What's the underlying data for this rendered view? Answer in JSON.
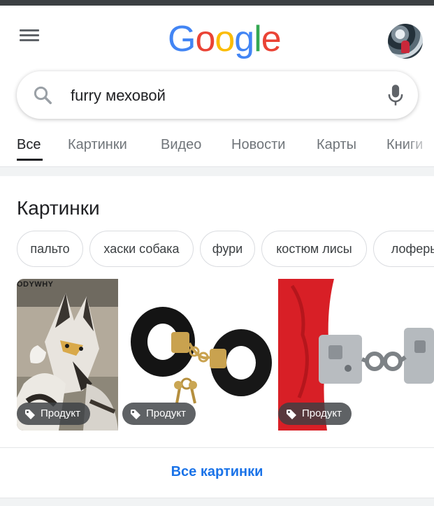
{
  "header": {
    "logo_letters": [
      "G",
      "o",
      "o",
      "g",
      "l",
      "e"
    ],
    "logo_colors": [
      "#4285F4",
      "#EA4335",
      "#FBBC05",
      "#4285F4",
      "#34A853",
      "#EA4335"
    ],
    "menu_icon": "hamburger-menu-icon",
    "avatar_icon": "user-avatar"
  },
  "search": {
    "query": "furry меховой",
    "search_icon": "search-icon",
    "mic_icon": "microphone-icon"
  },
  "tabs": [
    {
      "label": "Все",
      "active": true
    },
    {
      "label": "Картинки",
      "active": false
    },
    {
      "label": "Видео",
      "active": false
    },
    {
      "label": "Новости",
      "active": false
    },
    {
      "label": "Карты",
      "active": false
    },
    {
      "label": "Книги",
      "active": false
    }
  ],
  "images_section": {
    "title": "Картинки",
    "chips": [
      "пальто",
      "хаски собака",
      "фури",
      "костюм лисы",
      "лоферы"
    ],
    "results": [
      {
        "watermark": "ODYWHY",
        "badge": "Продукт",
        "subject": "fursuit-wolf"
      },
      {
        "badge": "Продукт",
        "subject": "black-fur-handcuffs"
      },
      {
        "badge": "Продукт",
        "subject": "red-fur-handcuffs"
      }
    ],
    "badge_icon": "tag-icon",
    "all_images_link": "Все картинки"
  },
  "colors": {
    "link_blue": "#1a73e8",
    "text_primary": "#202124",
    "text_secondary": "#70757a",
    "separator": "#f1f3f4"
  }
}
